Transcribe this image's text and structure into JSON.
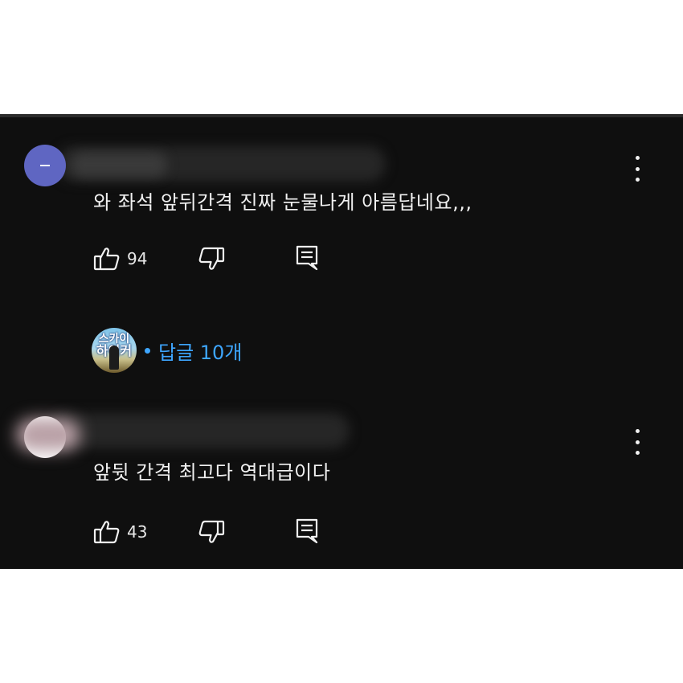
{
  "comments": [
    {
      "text": "와 좌석 앞뒤간격 진짜 눈물나게 아름답네요,,,",
      "likes": "94",
      "avatar_icon": "dash-icon",
      "avatar_color": "#5f66c2"
    },
    {
      "text": "앞뒷 간격 최고다 역대급이다",
      "likes": "43",
      "avatar_color": "#ffffff"
    }
  ],
  "replies": {
    "label": "답글 10개",
    "avatar_text_top": "스카이",
    "avatar_text_bottom": "하이커",
    "color": "#3ea6ff"
  },
  "icons": {
    "like": "thumbs-up-icon",
    "dislike": "thumbs-down-icon",
    "reply": "comment-icon",
    "menu": "more-vert-icon"
  },
  "colors": {
    "background": "#0f0f0f",
    "text": "#f1f1f1"
  }
}
